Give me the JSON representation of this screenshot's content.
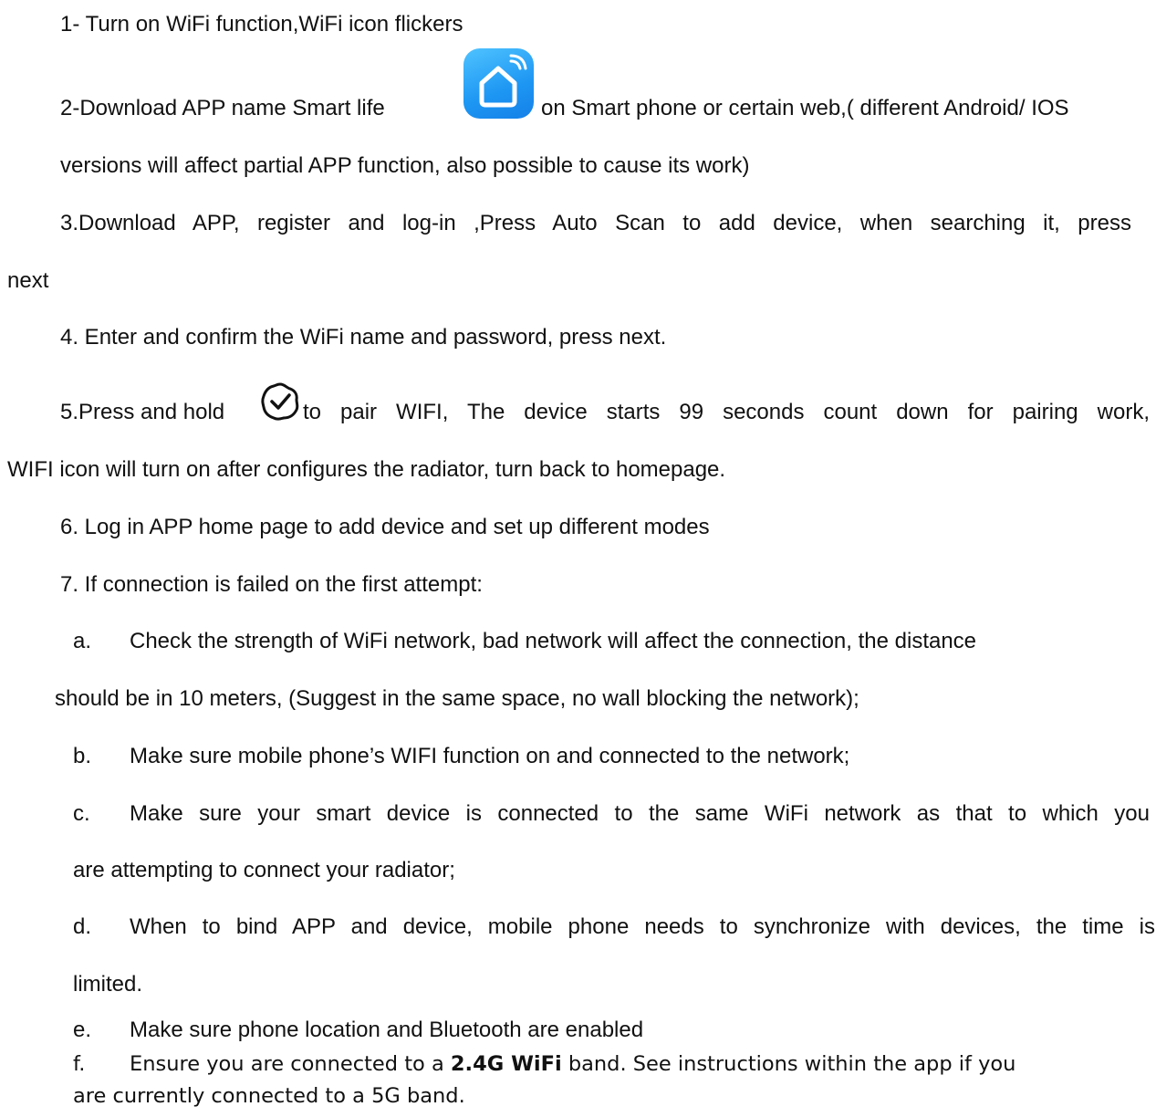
{
  "steps": {
    "s1": "1-  Turn on WiFi function,WiFi icon flickers",
    "s2_before": "2-Download APP name Smart life",
    "s2_after": "on Smart phone or certain web,( different Android/ IOS",
    "s2_cont": "versions will affect partial APP function, also possible to cause its work)",
    "s3": "3.Download APP, register and log-in ,Press Auto Scan to add device, when searching it, press",
    "s3_cont": "next",
    "s4": "4. Enter and confirm the WiFi name and password, press next.",
    "s5_before": "5.Press and hold",
    "s5_after": "to pair WIFI, The device starts 99 seconds count down for pairing work,",
    "s5_cont": "WIFI icon will turn on after configures the radiator, turn back to homepage.",
    "s6": "6. Log in APP home page to add device and set up different modes",
    "s7": "7. If connection is failed on the first attempt:"
  },
  "substeps": {
    "a_marker": "a.",
    "a_text": "Check the strength of WiFi network, bad network will affect the connection, the distance",
    "a_cont": "should be in 10 meters, (Suggest in the same space, no wall blocking the network);",
    "b_marker": "b.",
    "b_text": "Make sure mobile phone’s WIFI function on and connected to the network;",
    "c_marker": "c.",
    "c_text": "Make sure your smart device is connected to the same WiFi network as that to which you",
    "c_cont": "are attempting to connect your radiator;",
    "d_marker": "d.",
    "d_text": "When to bind APP and device, mobile phone needs to synchronize with devices, the time is",
    "d_cont": "limited.",
    "e_marker": "e.",
    "e_text": "Make sure phone location and Bluetooth are enabled",
    "f_marker": "f.",
    "f_text_before": "Ensure you are connected to a",
    "f_bold": "2.4G WiFi",
    "f_text_after": "band. See instructions within the app if you",
    "f_cont": "are currently connected to a 5G band."
  },
  "icons": {
    "app_icon": "smart-life-app-icon",
    "check_icon": "pair-check-icon",
    "app_color": "#1d96f3"
  }
}
